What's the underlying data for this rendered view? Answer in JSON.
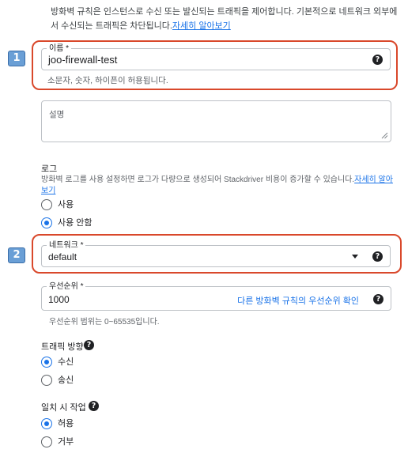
{
  "intro": {
    "text": "방화벽 규칙은 인스턴스로 수신 또는 발신되는 트래픽을 제어합니다. 기본적으로 네트워크 외부에서 수신되는 트래픽은 차단됩니다.",
    "link": "자세히 알아보기"
  },
  "badges": {
    "one": "1",
    "two": "2"
  },
  "name_field": {
    "label": "이름 *",
    "value": "joo-firewall-test",
    "help": "소문자, 숫자, 하이픈이 허용됩니다.",
    "help_icon": "?"
  },
  "description_field": {
    "placeholder": "설명"
  },
  "logs": {
    "title": "로그",
    "text": "방화벽 로그를 사용 설정하면 로그가 다량으로 생성되어 Stackdriver 비용이 증가할 수 있습니다.",
    "link": "자세히 알아보기",
    "options": [
      {
        "label": "사용",
        "selected": false
      },
      {
        "label": "사용 안함",
        "selected": true
      }
    ]
  },
  "network_field": {
    "label": "네트워크 *",
    "value": "default",
    "help_icon": "?"
  },
  "priority_field": {
    "label": "우선순위 *",
    "value": "1000",
    "link": "다른 방화벽 규칙의 우선순위 확인",
    "help": "우선순위 범위는 0~65535입니다.",
    "help_icon": "?"
  },
  "traffic_direction": {
    "title": "트래픽 방향",
    "help_icon": "?",
    "options": [
      {
        "label": "수신",
        "selected": true
      },
      {
        "label": "송신",
        "selected": false
      }
    ]
  },
  "action_on_match": {
    "title": "일치 시 작업",
    "help_icon": "?",
    "options": [
      {
        "label": "허용",
        "selected": true
      },
      {
        "label": "거부",
        "selected": false
      }
    ]
  },
  "colors": {
    "accent": "#1a73e8",
    "highlight": "#d9482b",
    "badge": "#6a9fd6"
  }
}
